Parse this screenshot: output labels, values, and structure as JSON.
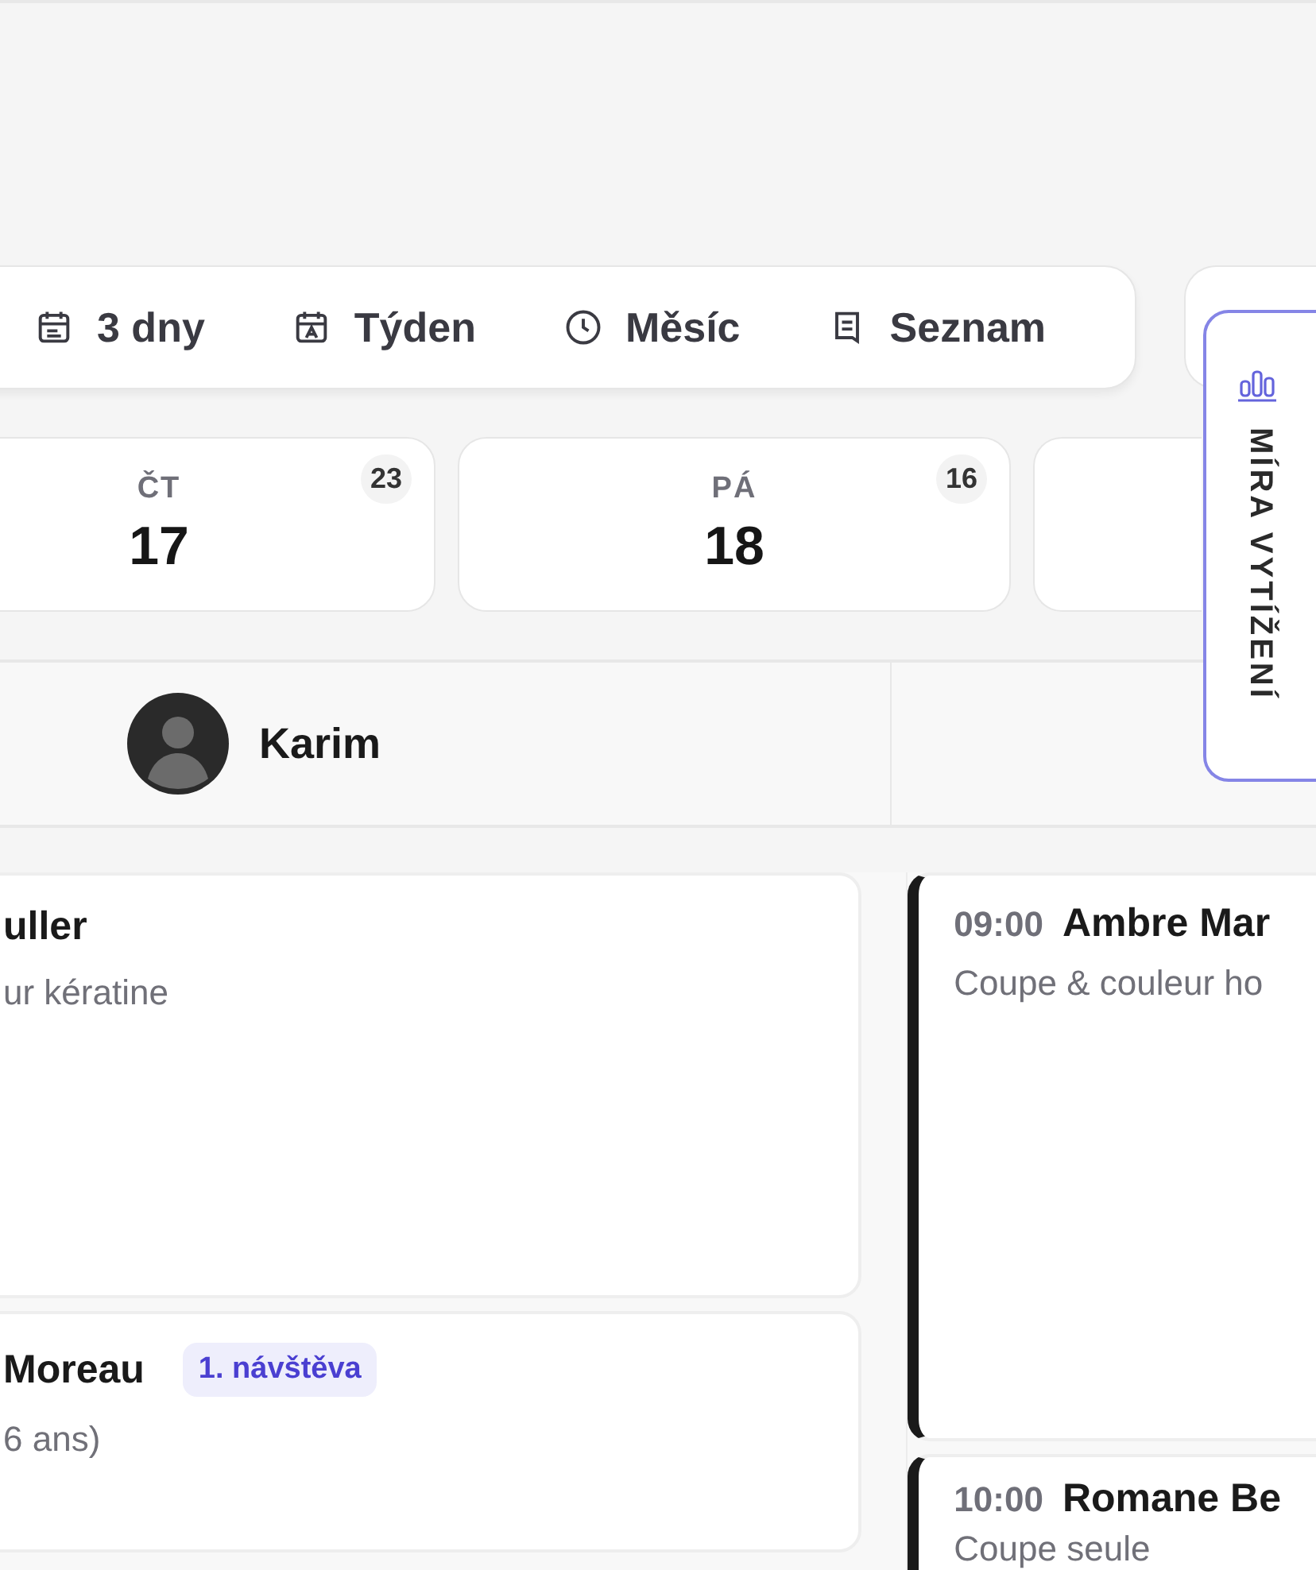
{
  "views": [
    {
      "label": "3 dny",
      "selected": false
    },
    {
      "label": "Týden",
      "selected": false
    },
    {
      "label": "Měsíc",
      "selected": false
    },
    {
      "label": "Seznam",
      "selected": false
    }
  ],
  "days": [
    {
      "weekday": "ČT",
      "date": "17",
      "count": "23"
    },
    {
      "weekday": "PÁ",
      "date": "18",
      "count": "16"
    }
  ],
  "staff": [
    {
      "name": "Karim"
    }
  ],
  "side_tab": {
    "label": "MÍRA VYTÍŽENÍ"
  },
  "columns": [
    {
      "appointments": [
        {
          "name": "uller",
          "service": "ur kératine"
        },
        {
          "name": "Moreau",
          "service": "6 ans)",
          "badge": "1. návštěva"
        }
      ]
    },
    {
      "appointments": [
        {
          "time": "09:00",
          "name": "Ambre Mar",
          "service": "Coupe & couleur ho",
          "color": "#1a1a1a"
        },
        {
          "time": "10:00",
          "name": "Romane Be",
          "service": "Coupe seule",
          "color": "#1a1a1a"
        }
      ]
    }
  ]
}
